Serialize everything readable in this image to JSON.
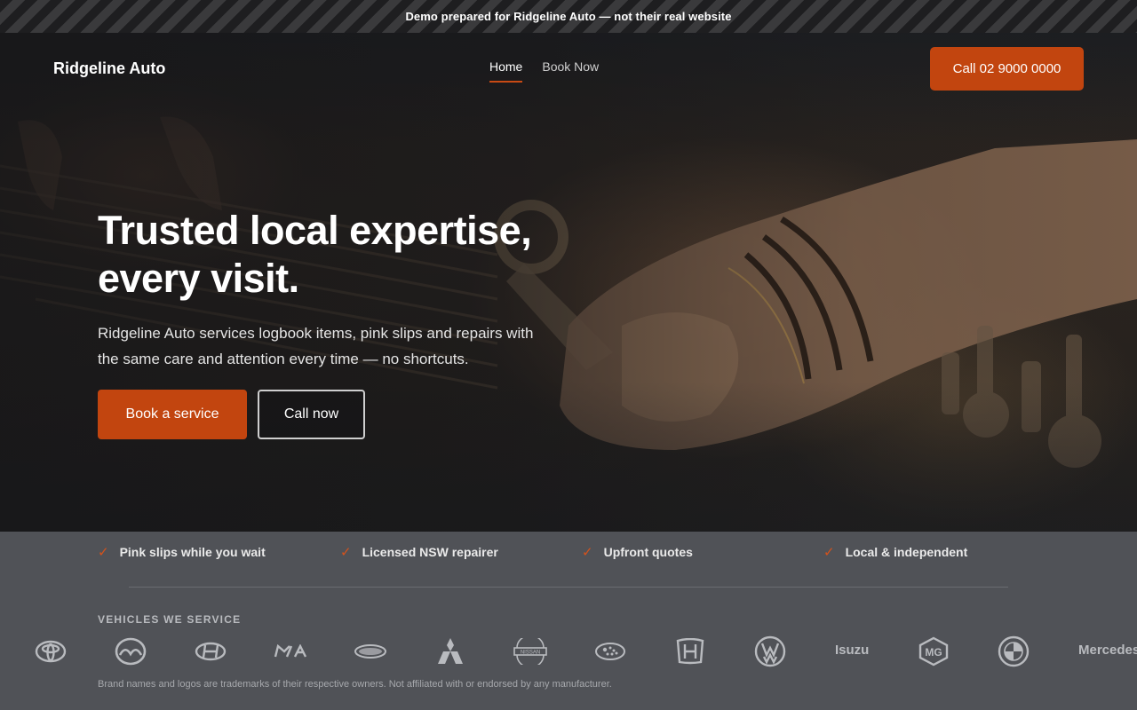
{
  "banner": {
    "text": "Demo prepared for Ridgeline Auto — not their real website"
  },
  "nav": {
    "brand": "Ridgeline Auto",
    "links": [
      {
        "label": "Home",
        "active": true
      },
      {
        "label": "Book Now",
        "active": false
      }
    ],
    "call_button": "Call 02 9000 0000"
  },
  "hero": {
    "title_line1": "Trusted local expertise,",
    "title_line2": "every visit.",
    "subtitle": "Ridgeline Auto services logbook items, pink slips and repairs with the same care and attention every time — no shortcuts.",
    "primary_cta": "Book a service",
    "secondary_cta": "Call now"
  },
  "features": [
    "Pink slips while you wait",
    "Licensed NSW repairer",
    "Upfront quotes",
    "Local & independent"
  ],
  "vehicles": {
    "label": "VEHICLES WE SERVICE",
    "brands": [
      "toyota-logo",
      "mazda-logo",
      "hyundai-logo",
      "kia-logo",
      "ford-logo",
      "mitsubishi-logo",
      "nissan-logo",
      "subaru-logo",
      "honda-logo",
      "volkswagen-logo",
      "Isuzu",
      "mg-logo",
      "bmw-logo",
      "Mercedes"
    ],
    "isuzu_text": "Isuzu",
    "mercedes_text": "Mercedes"
  },
  "disclaimer": "Brand names and logos are trademarks of their respective owners. Not affiliated with or endorsed by any manufacturer.",
  "colors": {
    "accent": "#c2450f",
    "check": "#d4521c",
    "trust_bg": "#505257"
  }
}
